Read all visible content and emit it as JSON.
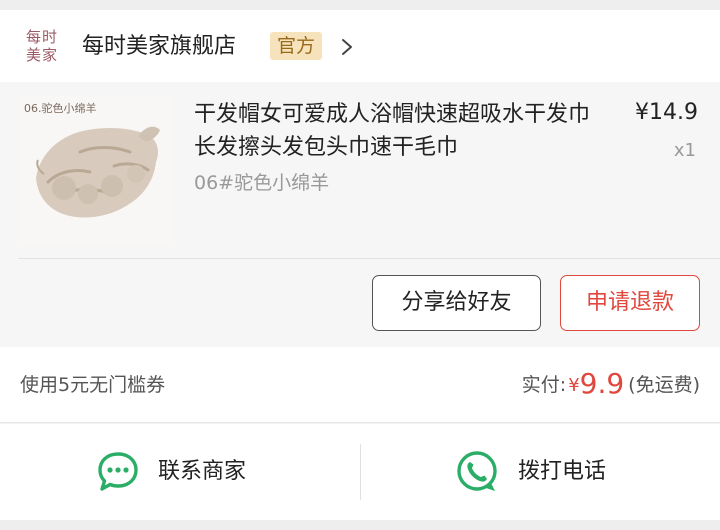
{
  "shop": {
    "logo_line1": "每时",
    "logo_line2": "美家",
    "name": "每时美家旗舰店",
    "badge": "官方",
    "chevron_icon": "chevron-right-icon"
  },
  "product": {
    "thumb_caption": "06.驼色小绵羊",
    "title": "干发帽女可爱成人浴帽快速超吸水干发巾长发擦头发包头巾速干毛巾",
    "variant": "06#驼色小绵羊",
    "price": "¥14.9",
    "quantity": "x1",
    "share_button": "分享给好友",
    "refund_button": "申请退款"
  },
  "payment": {
    "coupon": "使用5元无门槛券",
    "paid_label": "实付:",
    "currency": "¥",
    "amount": "9.9",
    "shipping_note": "(免运费)"
  },
  "contact": {
    "merchant_label": "联系商家",
    "merchant_icon": "chat-bubble-icon",
    "call_label": "拨打电话",
    "call_icon": "phone-icon"
  },
  "colors": {
    "accent_red": "#e0473d",
    "wechat_green": "#2aae67",
    "badge_bg": "#f7e3bb",
    "badge_text": "#9a6a1c"
  }
}
